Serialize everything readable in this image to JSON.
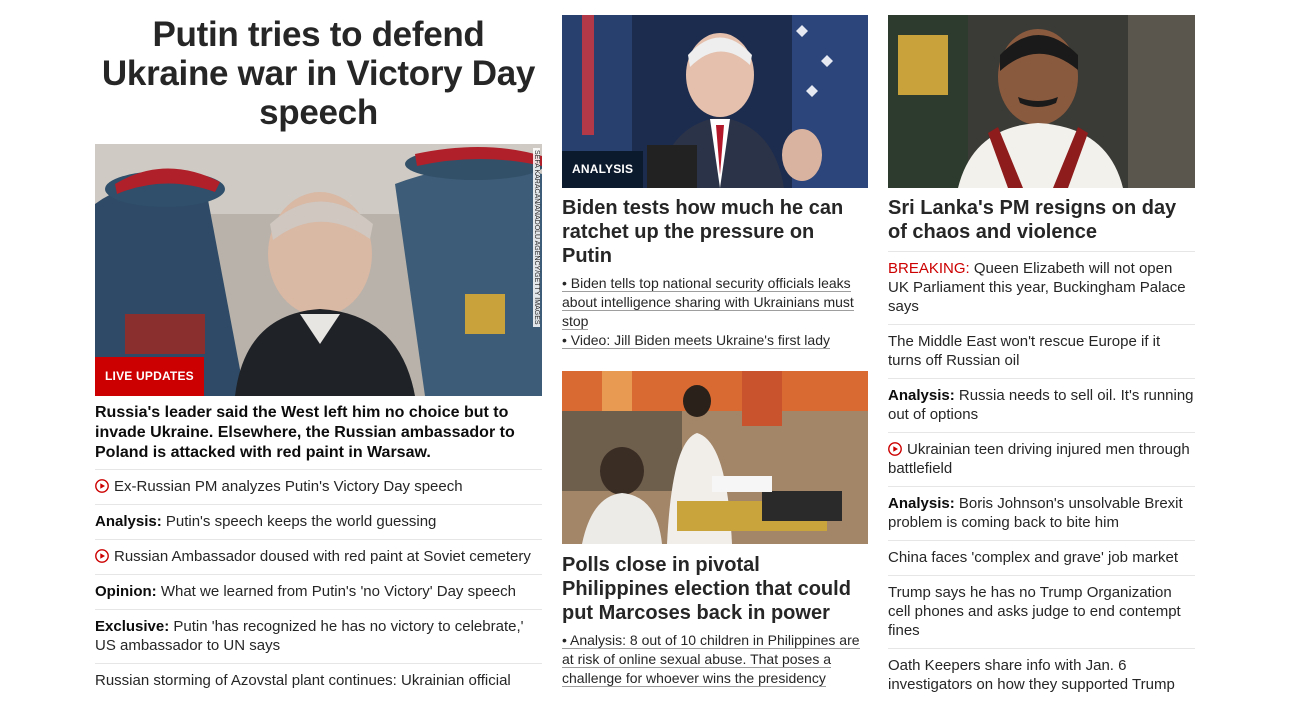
{
  "column1": {
    "headline": "Putin tries to defend Ukraine war in Victory Day speech",
    "image": {
      "credit": "SEFA KARACAN/ANADOLU AGENCY/GETTY IMAGES",
      "badge": "LIVE UPDATES"
    },
    "description": "Russia's leader said the West left him no choice but to invade Ukraine. Elsewhere, the Russian ambassador to Poland is attacked with red paint in Warsaw.",
    "items": [
      {
        "prefix": "",
        "text": "Ex-Russian PM analyzes Putin's Victory Day speech",
        "video": true
      },
      {
        "prefix": "Analysis:",
        "text": " Putin's speech keeps the world guessing",
        "video": false
      },
      {
        "prefix": "",
        "text": "Russian Ambassador doused with red paint at Soviet cemetery",
        "video": true
      },
      {
        "prefix": "Opinion:",
        "text": " What we learned from Putin's 'no Victory' Day speech",
        "video": false
      },
      {
        "prefix": "Exclusive:",
        "text": " Putin 'has recognized he has no victory to celebrate,' US ambassador to UN says",
        "video": false
      },
      {
        "prefix": "",
        "text": "Russian storming of Azovstal plant continues: Ukrainian official",
        "video": false
      }
    ]
  },
  "column2": {
    "story1": {
      "badge": "ANALYSIS",
      "headline": "Biden tests how much he can ratchet up the pressure on Putin",
      "bullets": [
        "• Biden tells top national security officials leaks about intelligence sharing with Ukrainians must stop",
        "• Video: Jill Biden meets Ukraine's first lady"
      ]
    },
    "story2": {
      "headline": "Polls close in pivotal Philippines election that could put Marcoses back in power",
      "bullets": [
        "• Analysis: 8 out of 10 children in Philippines are at risk of online sexual abuse. That poses a challenge for whoever wins the presidency"
      ]
    }
  },
  "column3": {
    "headline": "Sri Lanka's PM resigns on day of chaos and violence",
    "items": [
      {
        "prefix": "BREAKING:",
        "text": " Queen Elizabeth will not open UK Parliament this year, Buckingham Palace says",
        "style": "breaking",
        "video": false
      },
      {
        "prefix": "",
        "text": "The Middle East won't rescue Europe if it turns off Russian oil",
        "style": "",
        "video": false
      },
      {
        "prefix": "Analysis:",
        "text": " Russia needs to sell oil. It's running out of options",
        "style": "bold",
        "video": false
      },
      {
        "prefix": "",
        "text": "Ukrainian teen driving injured men through battlefield",
        "style": "",
        "video": true
      },
      {
        "prefix": "Analysis:",
        "text": " Boris Johnson's unsolvable Brexit problem is coming back to bite him",
        "style": "bold",
        "video": false
      },
      {
        "prefix": "",
        "text": "China faces 'complex and grave' job market",
        "style": "",
        "video": false
      },
      {
        "prefix": "",
        "text": "Trump says he has no Trump Organization cell phones and asks judge to end contempt fines",
        "style": "",
        "video": false
      },
      {
        "prefix": "",
        "text": "Oath Keepers share info with Jan. 6 investigators on how they supported Trump",
        "style": "",
        "video": false
      }
    ]
  },
  "colors": {
    "accent_red": "#cc0000",
    "badge_dark": "#0c1a2e",
    "divider": "#e6e6e6"
  },
  "icons": {
    "video": "play-circle-icon"
  }
}
